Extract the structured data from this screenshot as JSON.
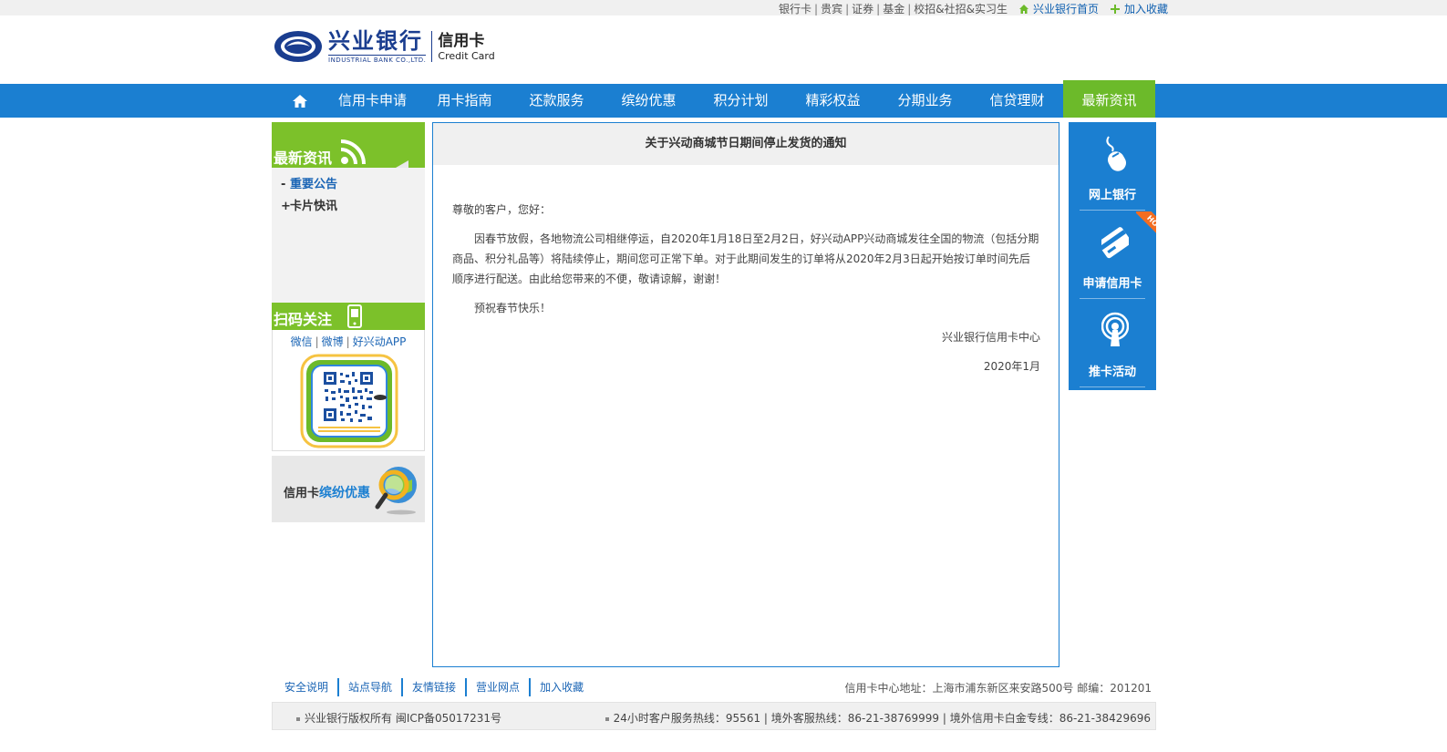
{
  "top_links": {
    "items": [
      "银行卡",
      "贵宾",
      "证券",
      "基金",
      "校招&社招&实习生"
    ],
    "home_label": "兴业银行首页",
    "fav_label": "加入收藏"
  },
  "header": {
    "logo_cn": "兴业银行",
    "logo_en": "INDUSTRIAL BANK CO.,LTD.",
    "sub_cn": "信用卡",
    "sub_en": "Credit Card"
  },
  "nav": {
    "items": [
      "信用卡申请",
      "用卡指南",
      "还款服务",
      "缤纷优惠",
      "积分计划",
      "精彩权益",
      "分期业务",
      "信贷理财",
      "最新资讯"
    ],
    "active_index": 8
  },
  "left": {
    "news_title": "最新资讯",
    "news_items": [
      {
        "bullet": "-",
        "label": "重要公告",
        "selected": true
      },
      {
        "bullet": "+",
        "label": "卡片快讯",
        "selected": false
      }
    ],
    "qr_title": "扫码关注",
    "qr_links": [
      "微信",
      "微博",
      "好兴动APP"
    ],
    "promo_prefix": "信用卡",
    "promo_highlight": "缤纷优惠"
  },
  "article": {
    "title": "关于兴动商城节日期间停止发货的通知",
    "greeting": "尊敬的客户，您好：",
    "paragraph": "因春节放假，各地物流公司相继停运，自2020年1月18日至2月2日，好兴动APP兴动商城发往全国的物流（包括分期商品、积分礼品等）将陆续停止，期间您可正常下单。对于此期间发生的订单将从2020年2月3日起开始按订单时间先后顺序进行配送。由此给您带来的不便，敬请谅解，谢谢！",
    "wishes": "预祝春节快乐！",
    "signature": "兴业银行信用卡中心",
    "date": "2020年1月"
  },
  "right": {
    "items": [
      "网上银行",
      "申请信用卡",
      "推卡活动"
    ],
    "hot_badge": "HOT"
  },
  "footer": {
    "links": [
      "安全说明",
      "站点导航",
      "友情链接",
      "营业网点",
      "加入收藏"
    ],
    "address": "信用卡中心地址：上海市浦东新区来安路500号 邮编：201201",
    "copyright": "兴业银行版权所有  闽ICP备05017231号",
    "hotlines": "24小时客户服务热线：95561 | 境外客服热线：86-21-38769999 | 境外信用卡白金专线：86-21-38429696"
  },
  "colors": {
    "nav_blue": "#1b7fd1",
    "active_green": "#6cba2a",
    "panel_green": "#7cc12a",
    "link_blue": "#1b65b5",
    "brand_navy": "#1a3d8f",
    "hot_orange": "#f36d21"
  },
  "icons": {
    "nav_home": "home-icon",
    "rss": "rss-icon",
    "phone": "phone-icon",
    "mouse": "mouse-icon",
    "card": "card-icon",
    "signal": "signal-icon",
    "magnifier": "magnifier-globe-icon"
  }
}
